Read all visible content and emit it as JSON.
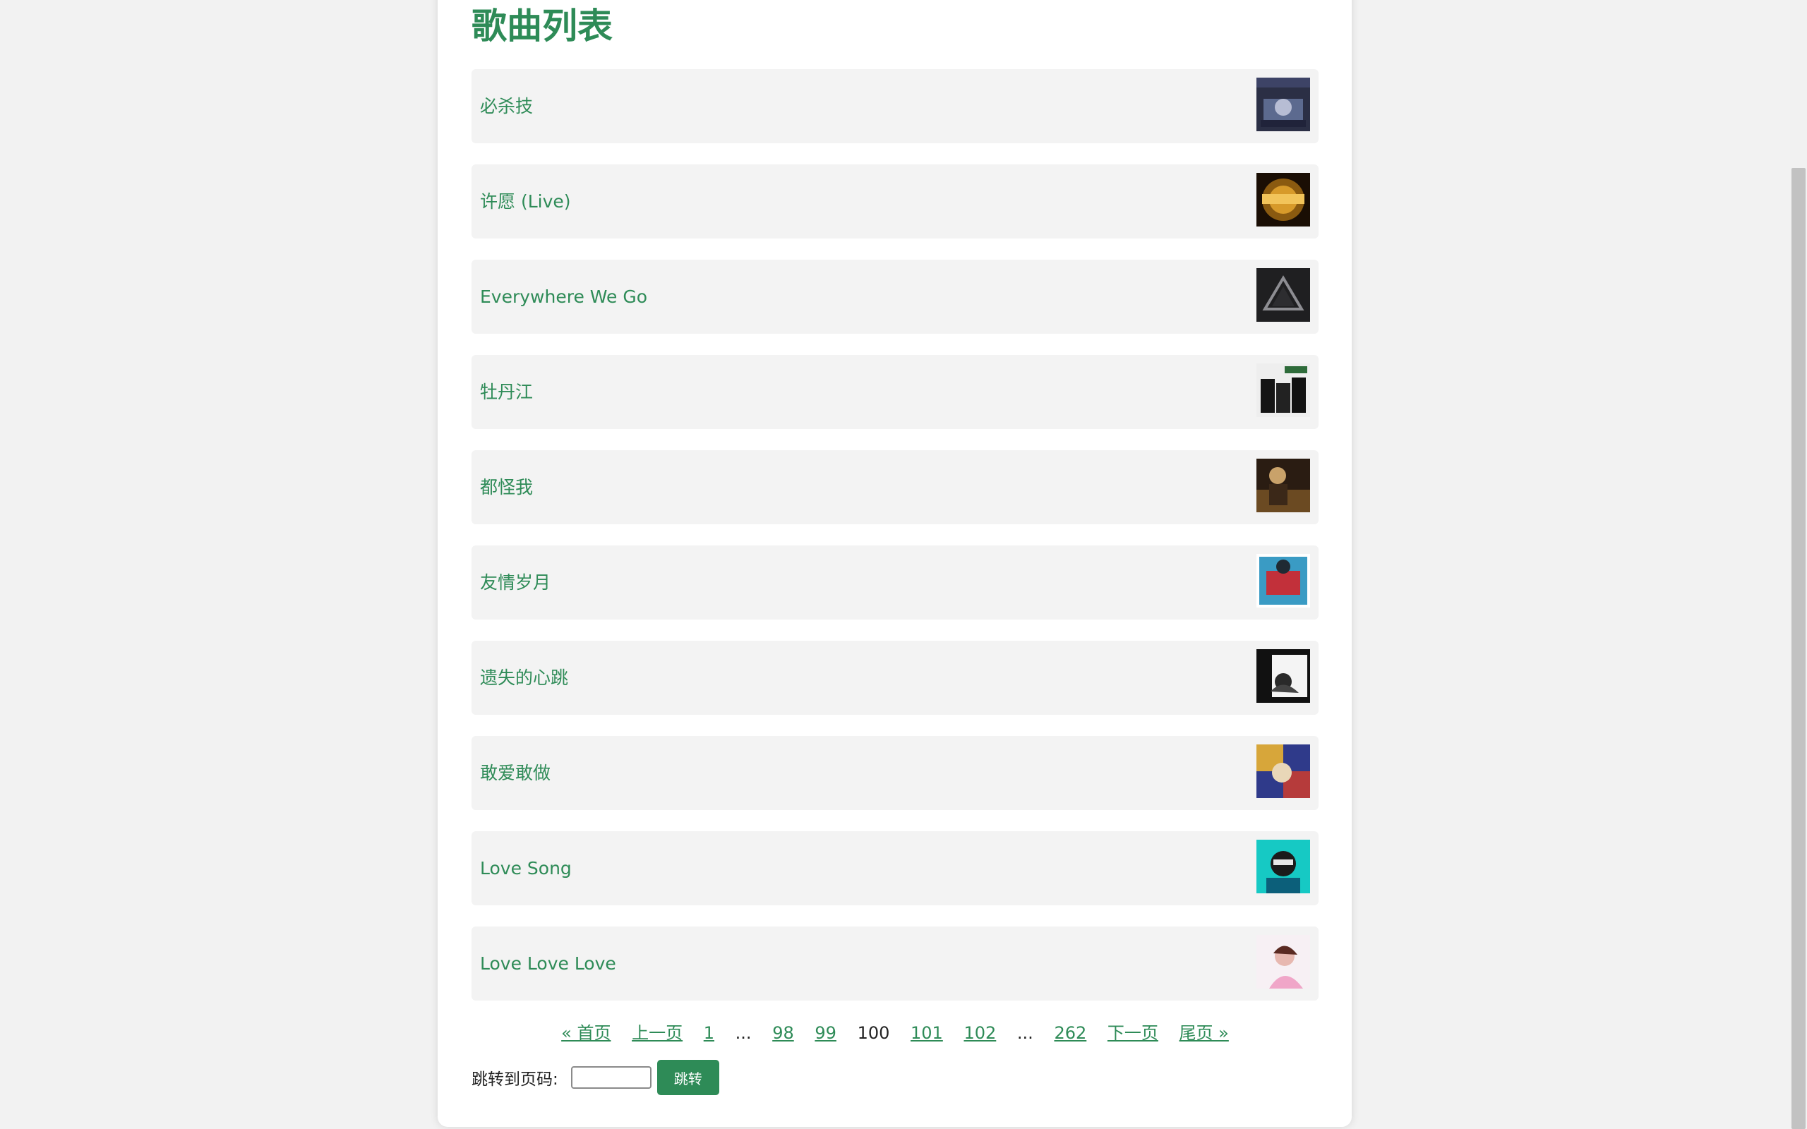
{
  "page": {
    "title": "歌曲列表"
  },
  "songs": [
    {
      "title": "必杀技",
      "cover": "album-cover-1"
    },
    {
      "title": "许愿 (Live)",
      "cover": "album-cover-2"
    },
    {
      "title": "Everywhere We Go",
      "cover": "album-cover-3"
    },
    {
      "title": "牡丹江",
      "cover": "album-cover-4"
    },
    {
      "title": "都怪我",
      "cover": "album-cover-5"
    },
    {
      "title": "友情岁月",
      "cover": "album-cover-6"
    },
    {
      "title": "遗失的心跳",
      "cover": "album-cover-7"
    },
    {
      "title": "敢爱敢做",
      "cover": "album-cover-8"
    },
    {
      "title": "Love Song",
      "cover": "album-cover-9"
    },
    {
      "title": "Love Love Love",
      "cover": "album-cover-10"
    }
  ],
  "pagination": {
    "first": "« 首页",
    "prev": "上一页",
    "page_1": "1",
    "ellipsis_left": "...",
    "page_98": "98",
    "page_99": "99",
    "current": "100",
    "page_101": "101",
    "page_102": "102",
    "ellipsis_right": "...",
    "last_page": "262",
    "next": "下一页",
    "last": "尾页 »"
  },
  "jump": {
    "label": "跳转到页码:",
    "input_value": "",
    "button_label": "跳转"
  },
  "colors": {
    "accent": "#2e8b57",
    "item_background": "#f3f3f3",
    "page_background": "#f2f2f2"
  }
}
